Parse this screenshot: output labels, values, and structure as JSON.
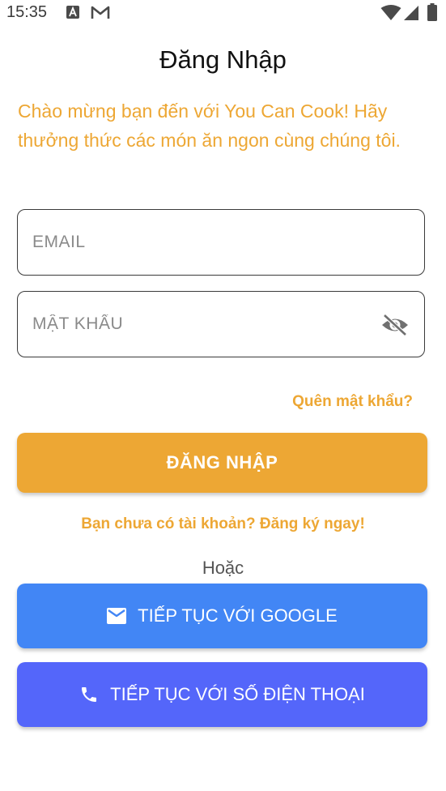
{
  "status_bar": {
    "time": "15:35",
    "icons": [
      "text-a-icon",
      "gmail-icon",
      "wifi-icon",
      "signal-icon",
      "battery-icon"
    ]
  },
  "login": {
    "title": "Đăng Nhập",
    "welcome": "Chào mừng bạn đến với You Can Cook! Hãy thưởng thức các món ăn ngon cùng chúng tôi.",
    "email_placeholder": "EMAIL",
    "password_placeholder": "MẬT KHẨU",
    "forgot_password": "Quên mật khẩu?",
    "login_button": "ĐĂNG NHẬP",
    "register_link": "Bạn chưa có tài khoản? Đăng ký ngay!",
    "or_label": "Hoặc",
    "google_button": "TIẾP TỤC VỚI GOOGLE",
    "phone_button": "TIẾP TỤC VỚI SỐ ĐIỆN THOẠI"
  },
  "colors": {
    "accent": "#eda734",
    "google": "#4286f5",
    "phone": "#5466fa"
  }
}
